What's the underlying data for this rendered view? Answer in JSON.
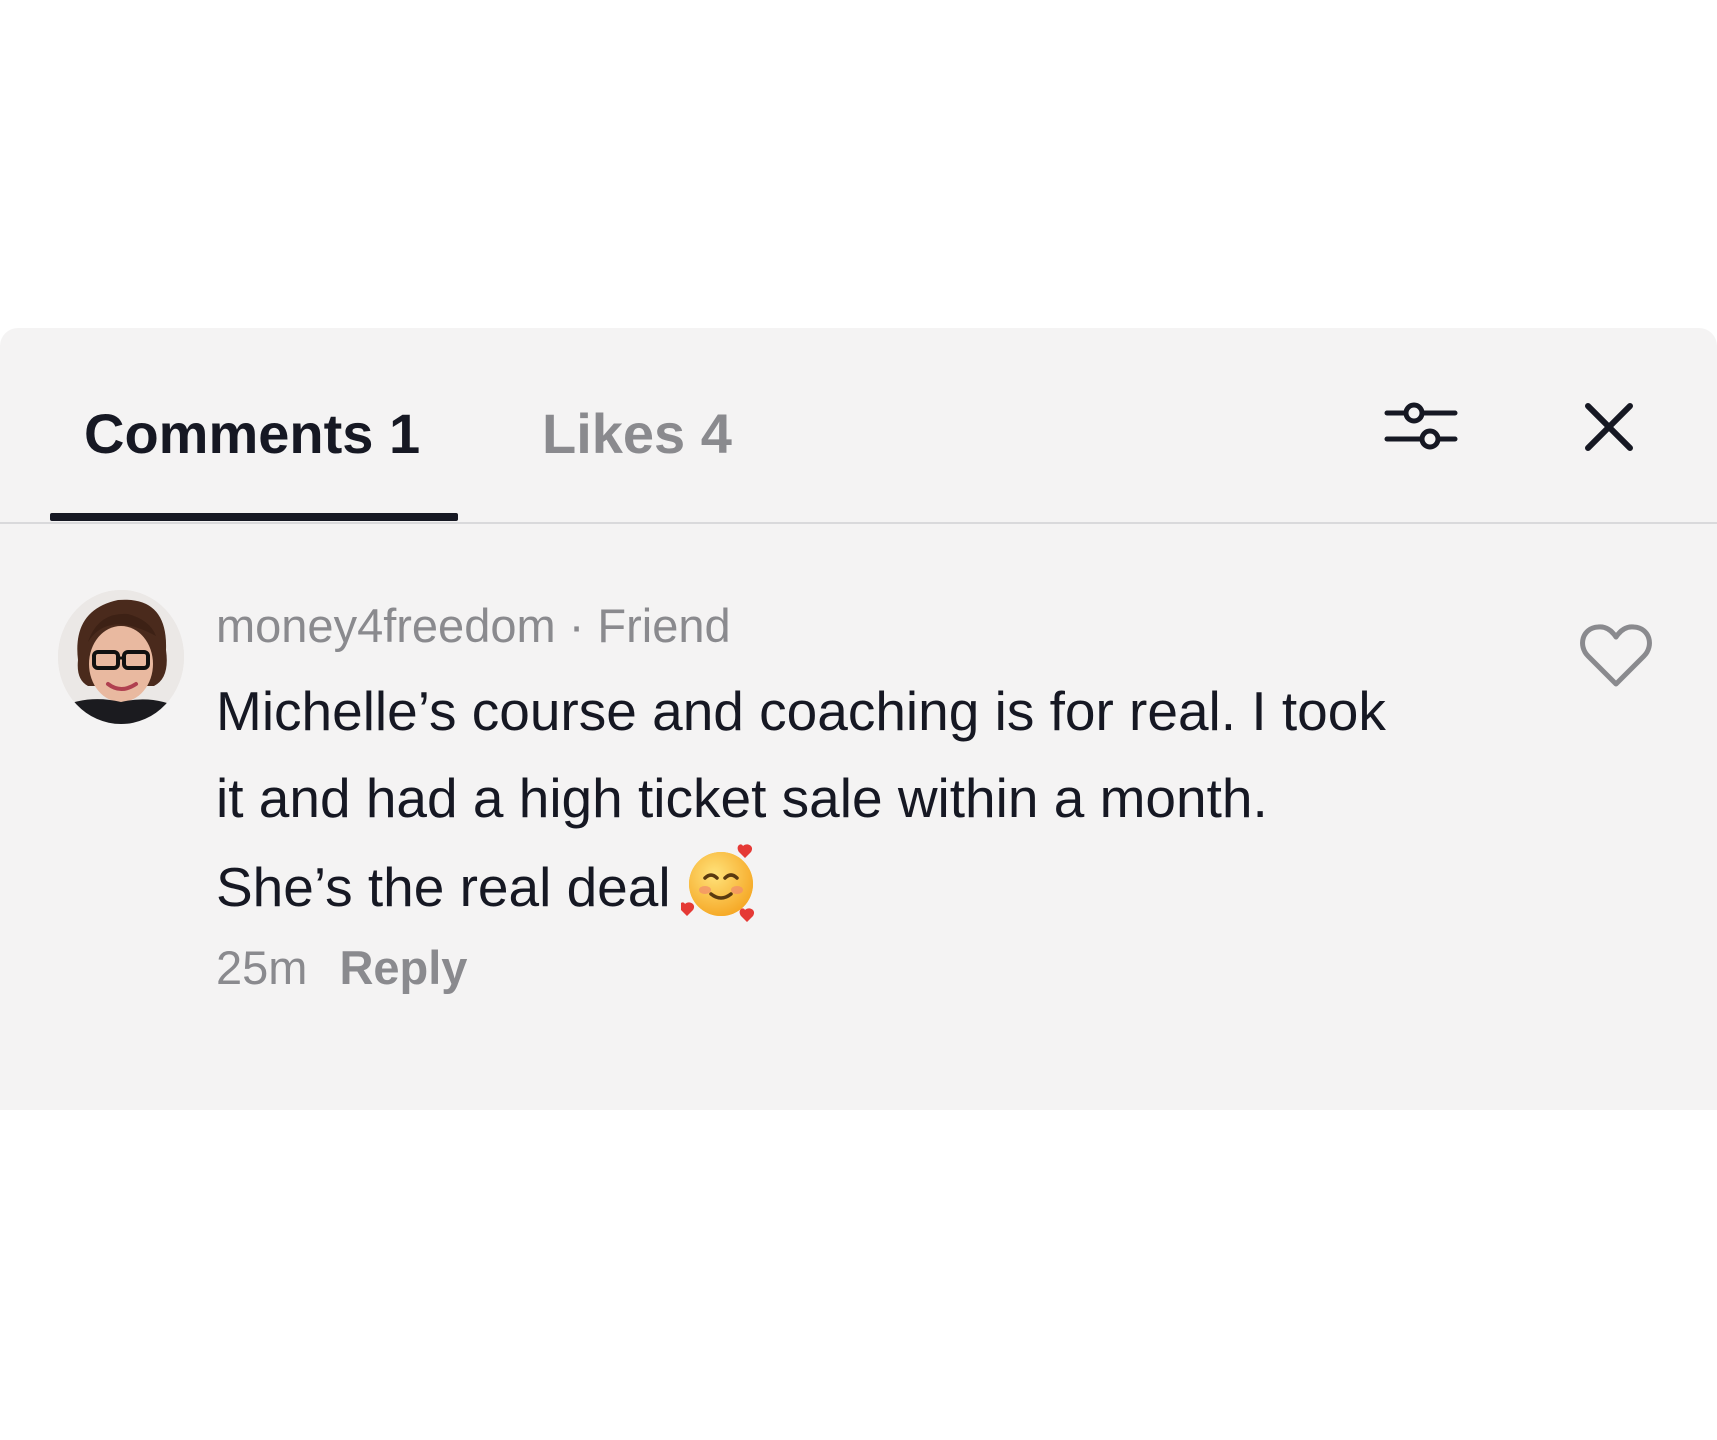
{
  "tabs": {
    "comments_label": "Comments 1",
    "likes_label": "Likes 4"
  },
  "header_icons": {
    "filter": "sliders-icon",
    "close": "close-icon"
  },
  "comment": {
    "username": "money4freedom",
    "separator": " · ",
    "relation": "Friend",
    "text": "Michelle’s course and coaching is for real. I took it and had a high ticket sale within a month. She’s the real deal",
    "emoji": "smiling-face-with-hearts",
    "time": "25m",
    "reply_label": "Reply",
    "like_icon": "heart-outline-icon"
  },
  "colors": {
    "panel_bg": "#f4f3f3",
    "primary_text": "#161823",
    "secondary_text": "#8a8a8e",
    "divider": "#d9d9db"
  }
}
